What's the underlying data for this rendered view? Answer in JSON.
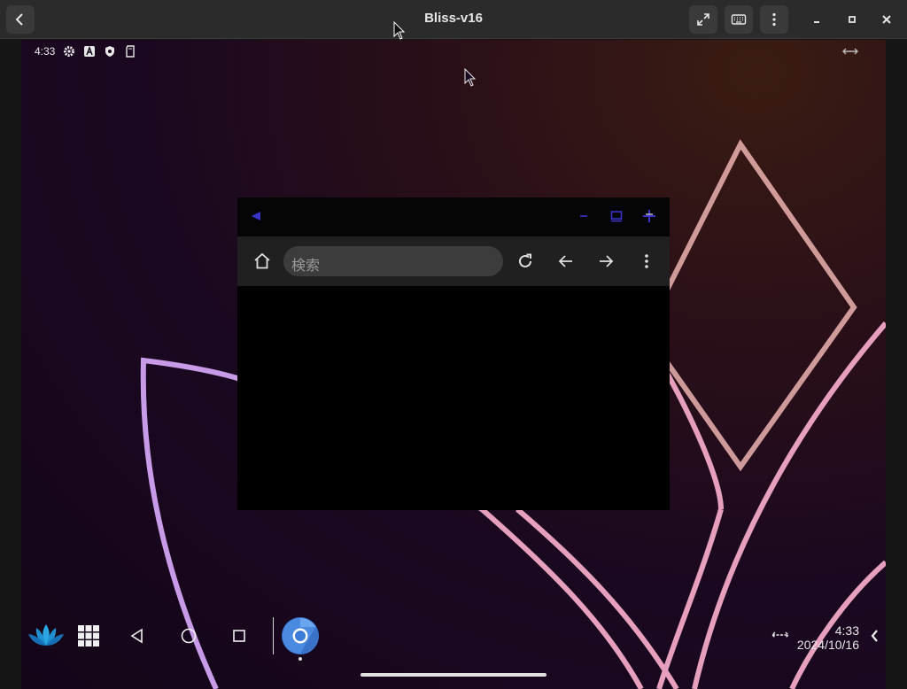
{
  "host": {
    "title": "Bliss-v16",
    "buttons": [
      "back-icon",
      "fullscreen-icon",
      "keyboard-icon",
      "more-vert-icon",
      "minimize-icon",
      "maximize-icon",
      "close-icon"
    ]
  },
  "statusbar": {
    "time": "4:33",
    "icons": [
      "settings-icon",
      "font-a-icon",
      "shield-icon",
      "sdcard-icon"
    ],
    "right_icon": "dock-arrows-icon"
  },
  "browser": {
    "caption_icons": [
      "collapse-arrow-icon",
      "minimize-icon",
      "window-icon",
      "close-icon"
    ],
    "search_placeholder": "検索",
    "toolbar_icons": [
      "home-icon",
      "reload-icon",
      "back-arrow-icon",
      "forward-arrow-icon",
      "menu-icon"
    ]
  },
  "taskbar": {
    "launcher": "lotus-icon",
    "all_apps": "grid-icon",
    "nav": [
      "back-triangle-icon",
      "home-circle-icon",
      "recents-square-icon"
    ],
    "running_app": "chromium-icon",
    "clock_time": "4:33",
    "clock_date": "2024/10/16"
  },
  "colors": {
    "host_bar": "#2b2b2b",
    "accent_blue": "#3b32c8",
    "wallpaper_line_pink": "#f0a8c8",
    "wallpaper_line_violet": "#c89be8"
  }
}
